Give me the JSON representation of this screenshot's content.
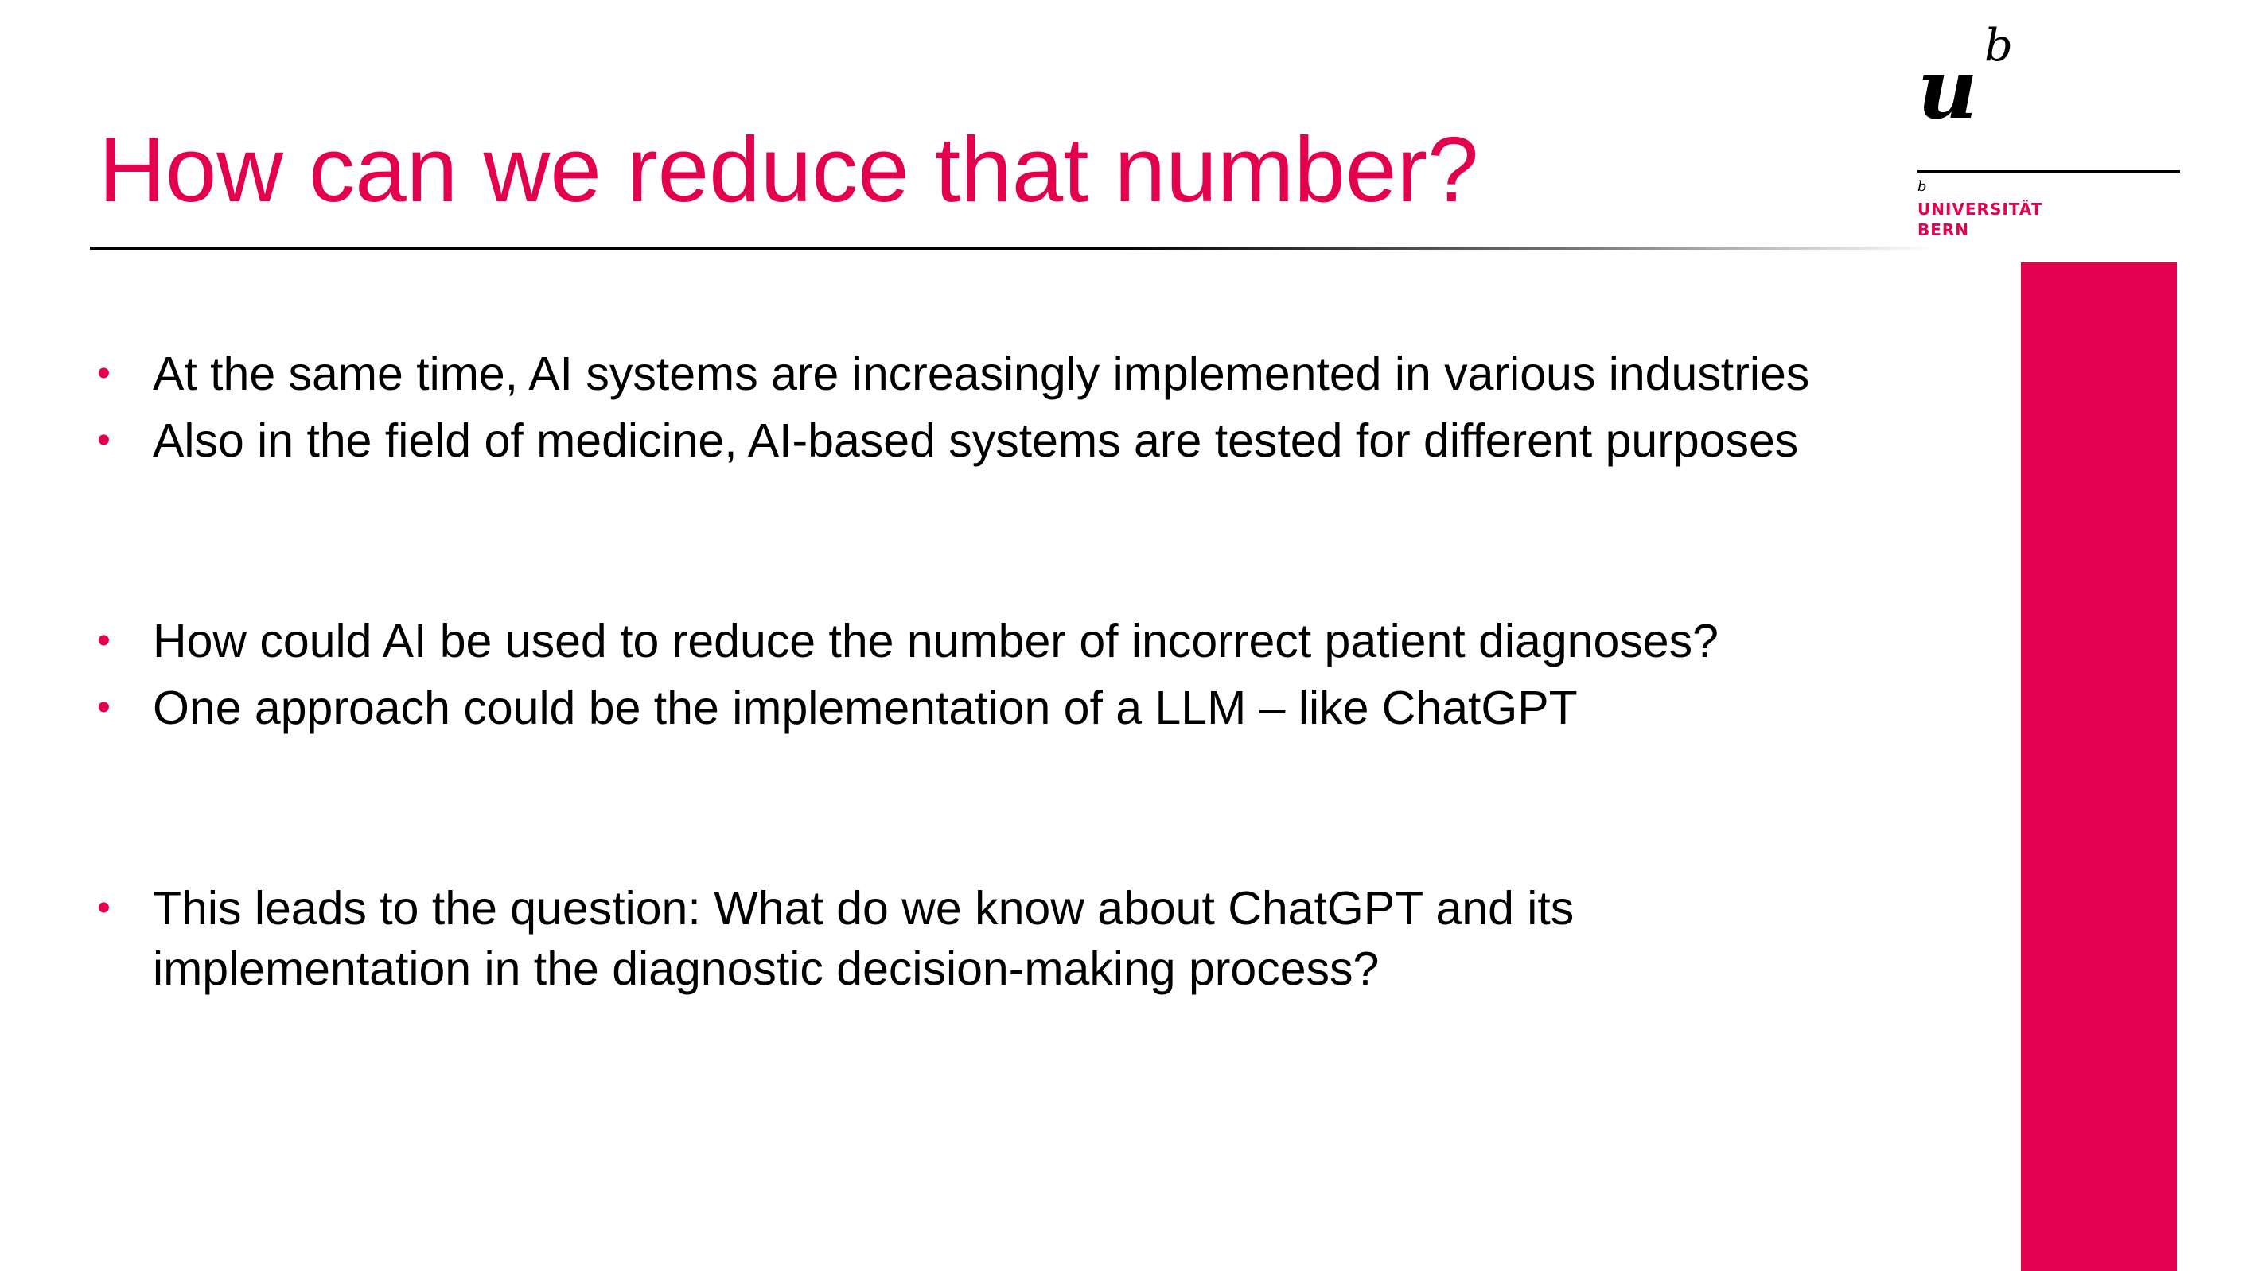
{
  "slide": {
    "title": "How can we reduce that number?",
    "logo": {
      "mark_u": "u",
      "mark_b": "b",
      "small_b": "b",
      "line1": "UNIVERSITÄT",
      "line2": "BERN"
    },
    "bullet_glyph": "•",
    "bullets": [
      {
        "lines": [
          "At the same time, AI systems are increasingly implemented in various industries"
        ]
      },
      {
        "lines": [
          "Also in the field of medicine, AI-based systems are tested for different purposes"
        ]
      },
      {
        "lines": [
          "How could AI be used to reduce the number of incorrect patient diagnoses?"
        ]
      },
      {
        "lines": [
          "One approach could be the implementation of a LLM – like ChatGPT"
        ]
      },
      {
        "lines": [
          "This leads to the question: What do we know about ChatGPT and its",
          "implementation in the diagnostic decision-making process?"
        ]
      }
    ]
  },
  "colors": {
    "accent": "#e3004f",
    "text": "#000000",
    "background": "#ffffff"
  }
}
